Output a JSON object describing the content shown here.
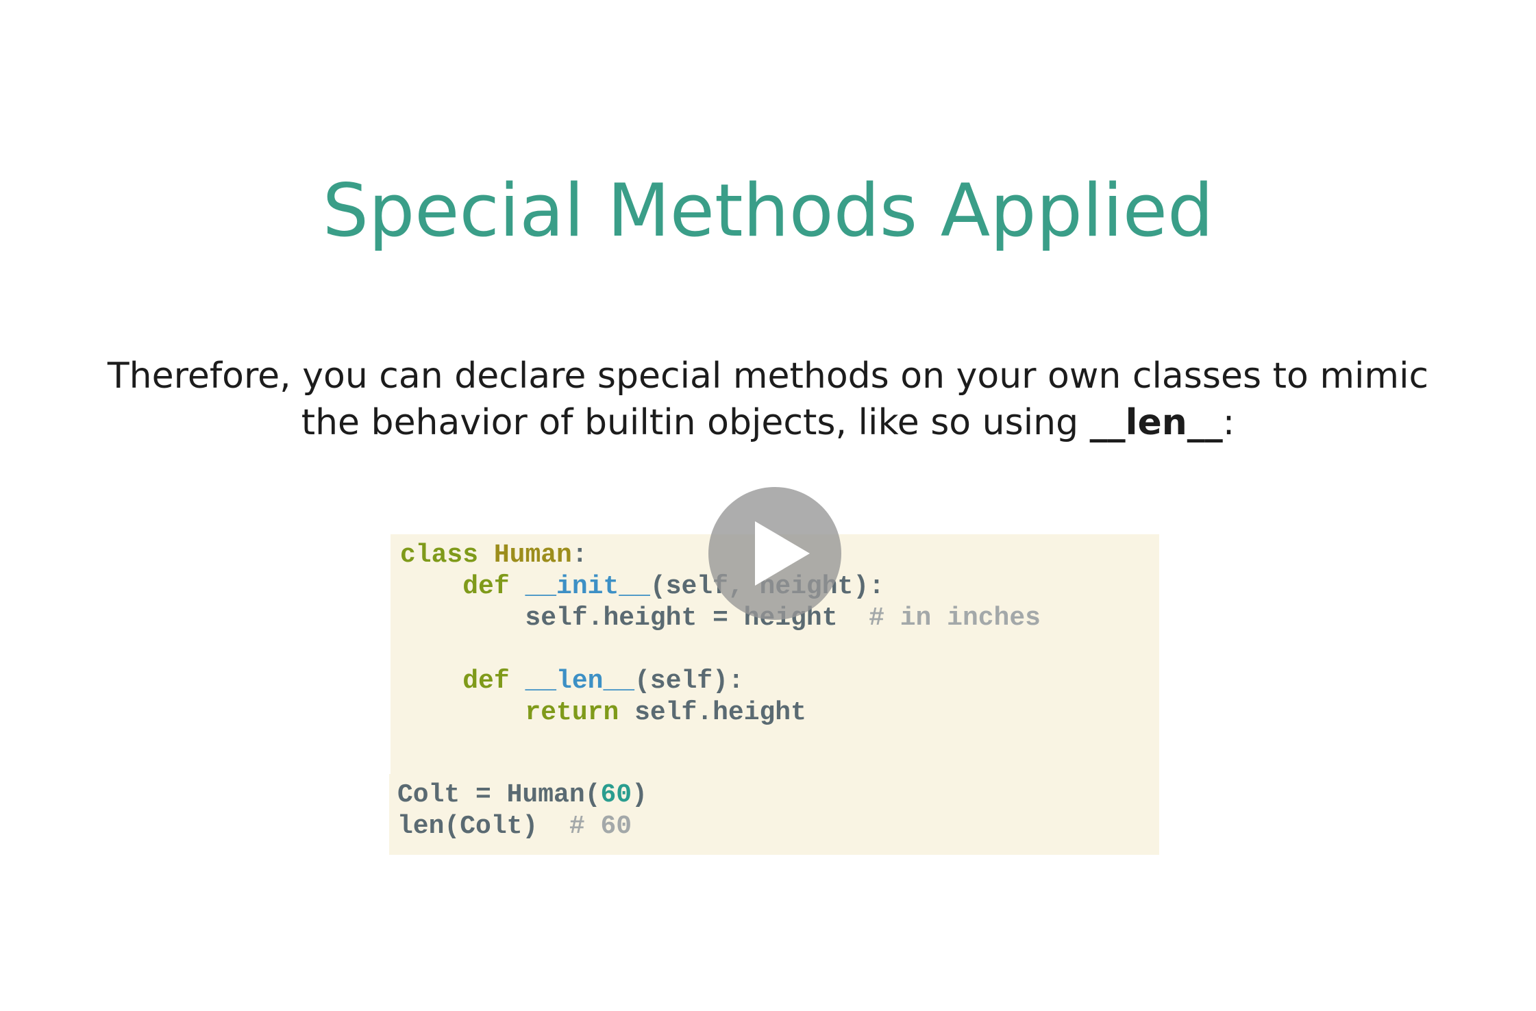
{
  "slide": {
    "title": "Special Methods Applied",
    "intro_part1": "Therefore, you can declare special methods on your own classes to mimic",
    "intro_part2": "the behavior of builtin objects, like so using ",
    "intro_bold": "__len__",
    "intro_end": ":"
  },
  "code": {
    "line1": {
      "kw": "class",
      "space": " ",
      "cls": "Human",
      "rest": ":"
    },
    "line2": {
      "indent": "    ",
      "kw": "def",
      "space": " ",
      "fn": "__init__",
      "rest": "(self, height):"
    },
    "line3": {
      "code": "        self.height = height  ",
      "cmt": "# in inches"
    },
    "line4": {
      "indent": "    ",
      "kw": "def",
      "space": " ",
      "fn": "__len__",
      "rest": "(self):"
    },
    "line5": {
      "indent": "        ",
      "kw": "return",
      "rest": " self.height"
    },
    "line6": {
      "code": "Colt = Human(",
      "num": "60",
      "rest": ")"
    },
    "line7": {
      "code": "len(Colt)  ",
      "cmt": "# 60"
    }
  },
  "colors": {
    "title": "#3a9e88",
    "code_background": "#f9f4e3",
    "keyword": "#7f9a1a",
    "class_name": "#9c8d1c",
    "function_name": "#3d90c5",
    "number": "#2a9d8f",
    "comment": "#a3a8a9"
  },
  "icons": {
    "play": "play-icon"
  }
}
